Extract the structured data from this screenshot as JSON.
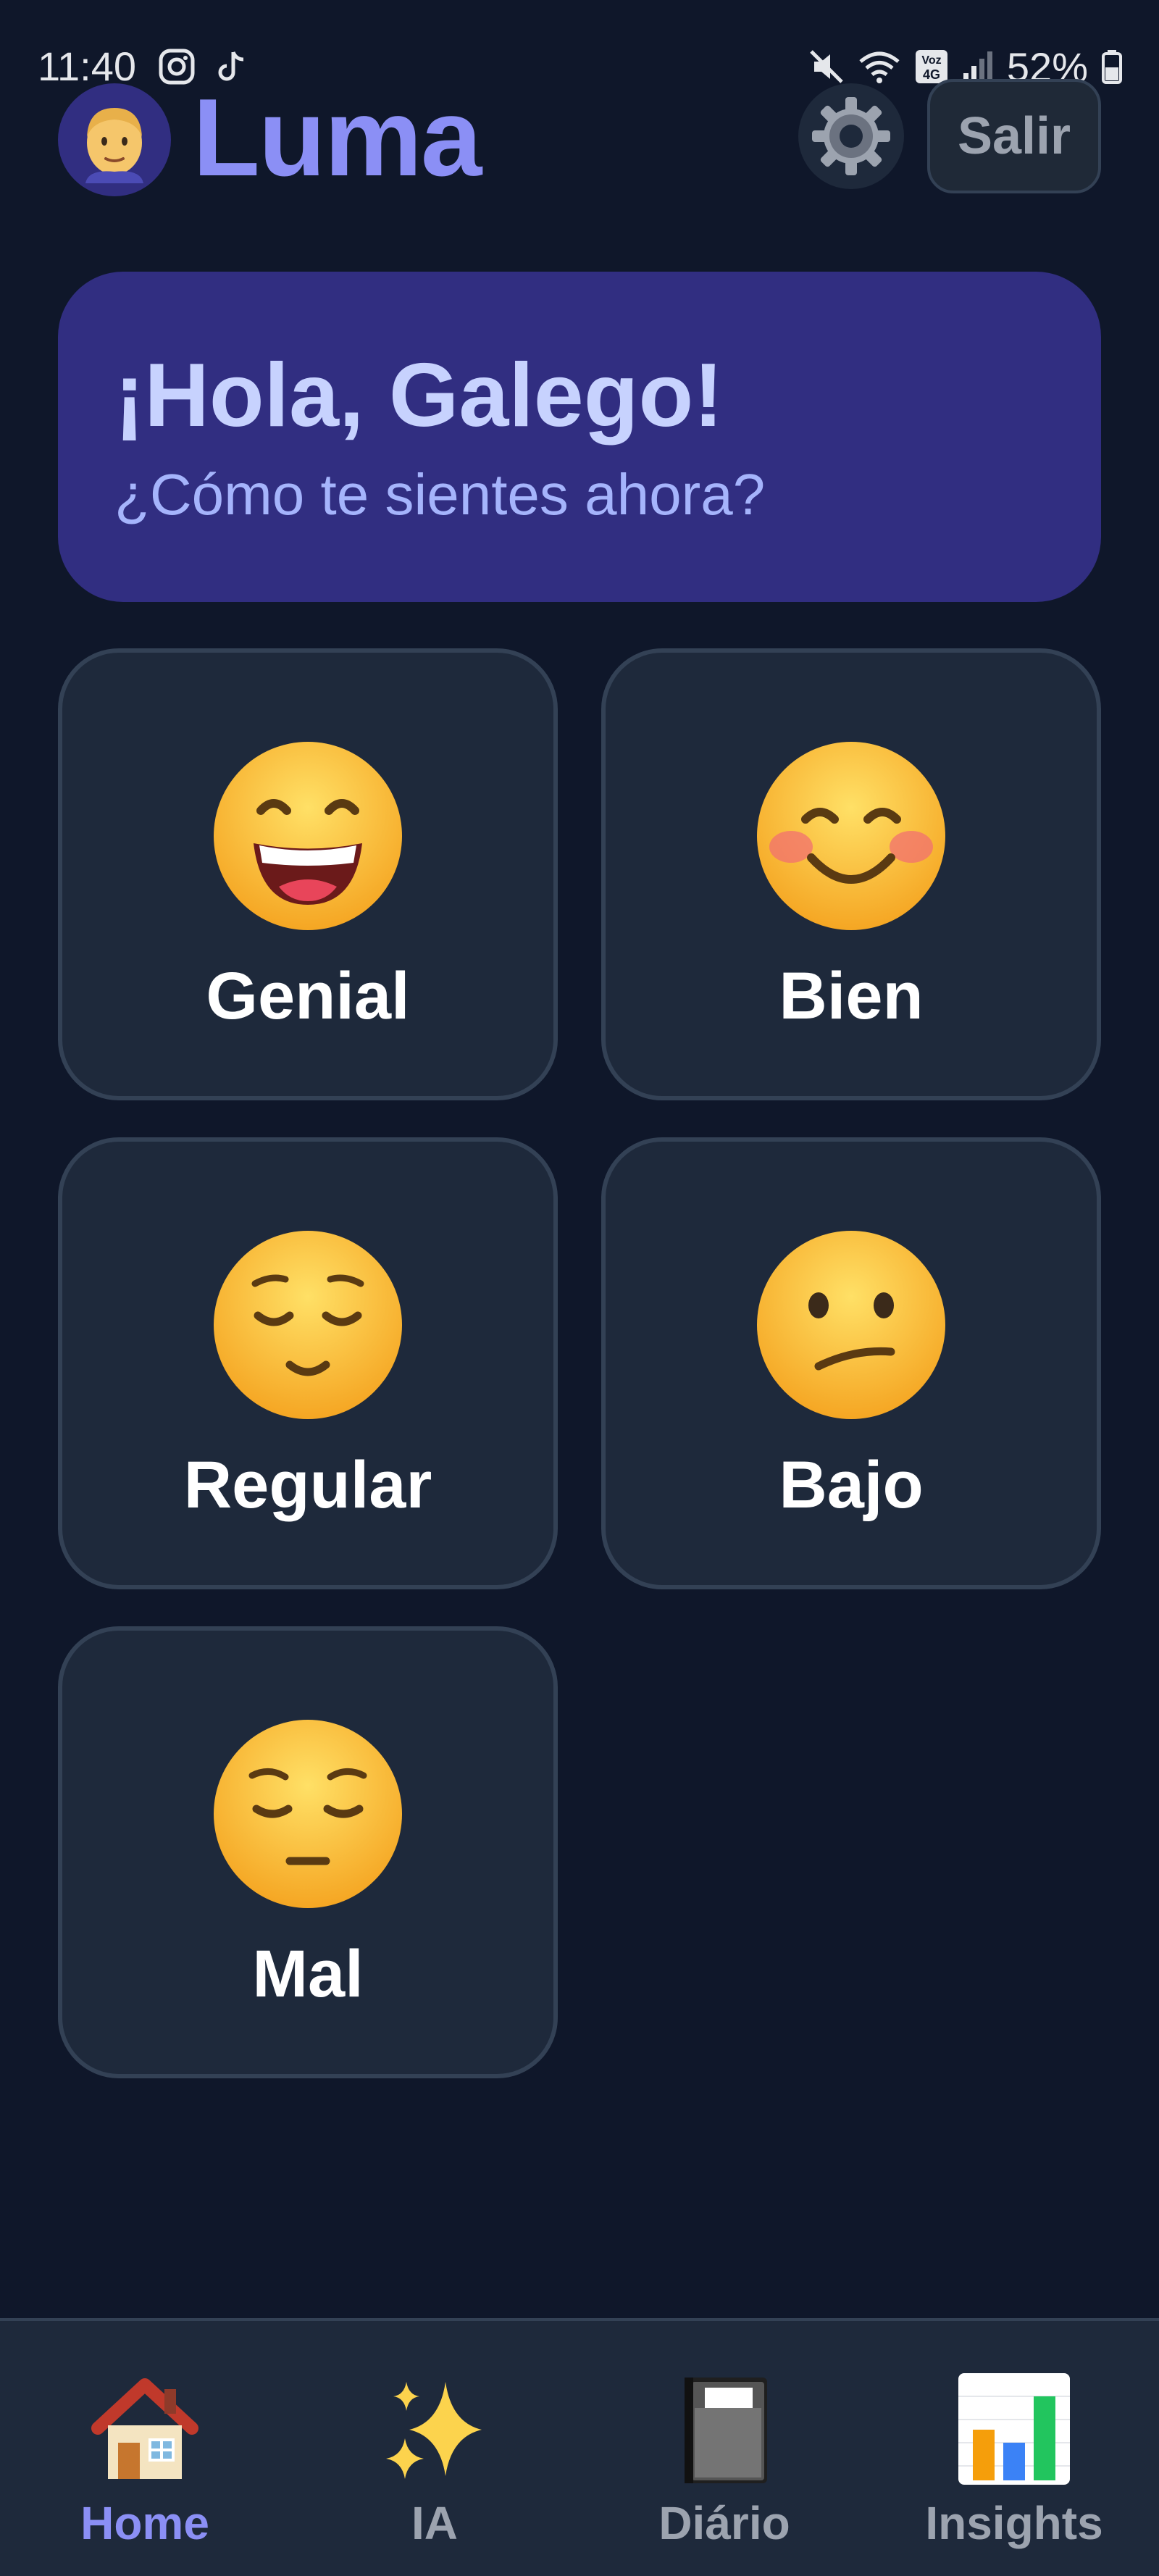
{
  "status": {
    "time": "11:40",
    "battery": "52%"
  },
  "header": {
    "title": "Luma",
    "logout_label": "Salir"
  },
  "greeting": {
    "title": "¡Hola, Galego!",
    "subtitle": "¿Cómo te sientes ahora?"
  },
  "moods": [
    {
      "label": "Genial",
      "icon": "grinning-face-icon"
    },
    {
      "label": "Bien",
      "icon": "smiling-face-icon"
    },
    {
      "label": "Regular",
      "icon": "relieved-face-icon"
    },
    {
      "label": "Bajo",
      "icon": "confused-face-icon"
    },
    {
      "label": "Mal",
      "icon": "pensive-face-icon"
    }
  ],
  "nav": {
    "items": [
      {
        "label": "Home",
        "icon": "house-icon",
        "active": true
      },
      {
        "label": "IA",
        "icon": "sparkles-icon",
        "active": false
      },
      {
        "label": "Diário",
        "icon": "notebook-icon",
        "active": false
      },
      {
        "label": "Insights",
        "icon": "bar-chart-icon",
        "active": false
      }
    ]
  },
  "colors": {
    "background": "#0f172a",
    "card": "#1e293b",
    "accent": "#8b8ff5",
    "greeting_card": "#312e81"
  }
}
